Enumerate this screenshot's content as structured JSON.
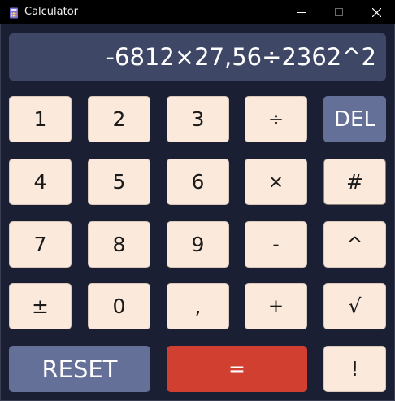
{
  "window": {
    "title": "Calculator",
    "controls": {
      "minimize": "—",
      "maximize": "☐",
      "close": "✕"
    }
  },
  "display": {
    "expression": "-6812×27,56÷2362^2"
  },
  "keys": {
    "k1": "1",
    "k2": "2",
    "k3": "3",
    "divide": "÷",
    "del": "DEL",
    "k4": "4",
    "k5": "5",
    "k6": "6",
    "multiply": "×",
    "hash": "#",
    "k7": "7",
    "k8": "8",
    "k9": "9",
    "minus": "-",
    "power": "^",
    "plusminus": "±",
    "k0": "0",
    "comma": ",",
    "plus": "+",
    "sqrt": "√",
    "reset": "RESET",
    "equals": "=",
    "factorial": "!"
  },
  "colors": {
    "background": "#1b1f33",
    "display": "#3f4767",
    "key": "#fbeadb",
    "accent_blue": "#647097",
    "equals_red": "#d03f30"
  },
  "icons": {
    "app": "calculator-app-icon"
  }
}
